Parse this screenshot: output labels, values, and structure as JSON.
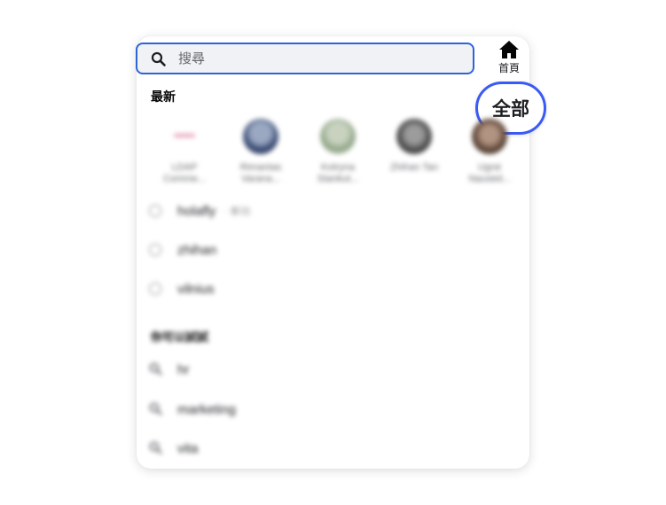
{
  "search": {
    "placeholder": "搜尋",
    "value": ""
  },
  "home": {
    "label": "首頁"
  },
  "all_button": {
    "label": "全部"
  },
  "recent": {
    "title": "最新",
    "people": [
      {
        "name": "LDAP Comme..."
      },
      {
        "name": "Rimantas Varana..."
      },
      {
        "name": "Kotryna Stankut..."
      },
      {
        "name": "Zhihan Tan"
      },
      {
        "name": "Ugnė Nausėd..."
      }
    ],
    "history": [
      {
        "text": "holafly",
        "meta": "· 新功"
      },
      {
        "text": "zhihan",
        "meta": ""
      },
      {
        "text": "vilnius",
        "meta": ""
      }
    ]
  },
  "suggestions": {
    "title": "你可以試試",
    "items": [
      {
        "text": "hr"
      },
      {
        "text": "marketing"
      },
      {
        "text": "vita"
      }
    ]
  },
  "colors": {
    "accent": "#2f63d8",
    "pill_border": "#3a5af5",
    "field_bg": "#f0f2f5"
  }
}
